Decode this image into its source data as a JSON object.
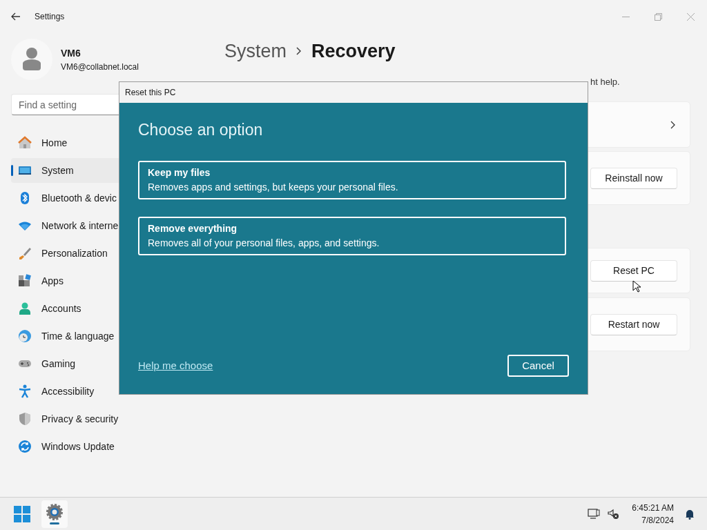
{
  "window": {
    "title": "Settings"
  },
  "account": {
    "name": "VM6",
    "email": "VM6@collabnet.local"
  },
  "search": {
    "placeholder": "Find a setting"
  },
  "sidebar": {
    "items": [
      {
        "label": "Home",
        "selected": false
      },
      {
        "label": "System",
        "selected": true
      },
      {
        "label": "Bluetooth & devic",
        "selected": false
      },
      {
        "label": "Network & interne",
        "selected": false
      },
      {
        "label": "Personalization",
        "selected": false
      },
      {
        "label": "Apps",
        "selected": false
      },
      {
        "label": "Accounts",
        "selected": false
      },
      {
        "label": "Time & language",
        "selected": false
      },
      {
        "label": "Gaming",
        "selected": false
      },
      {
        "label": "Accessibility",
        "selected": false
      },
      {
        "label": "Privacy & security",
        "selected": false
      },
      {
        "label": "Windows Update",
        "selected": false
      }
    ]
  },
  "breadcrumb": {
    "parent": "System",
    "current": "Recovery"
  },
  "description": "ht help.",
  "cards": [
    {
      "kind": "chevron"
    },
    {
      "kind": "button",
      "button": "Reinstall now"
    },
    {
      "kind": "button",
      "button": "Reset PC"
    },
    {
      "kind": "button",
      "button": "Restart now"
    }
  ],
  "dialog": {
    "title": "Reset this PC",
    "heading": "Choose an option",
    "options": [
      {
        "title": "Keep my files",
        "description": "Removes apps and settings, but keeps your personal files."
      },
      {
        "title": "Remove everything",
        "description": "Removes all of your personal files, apps, and settings."
      }
    ],
    "help_link": "Help me choose",
    "cancel": "Cancel"
  },
  "taskbar": {
    "time": "6:45:21 AM",
    "date": "7/8/2024"
  }
}
